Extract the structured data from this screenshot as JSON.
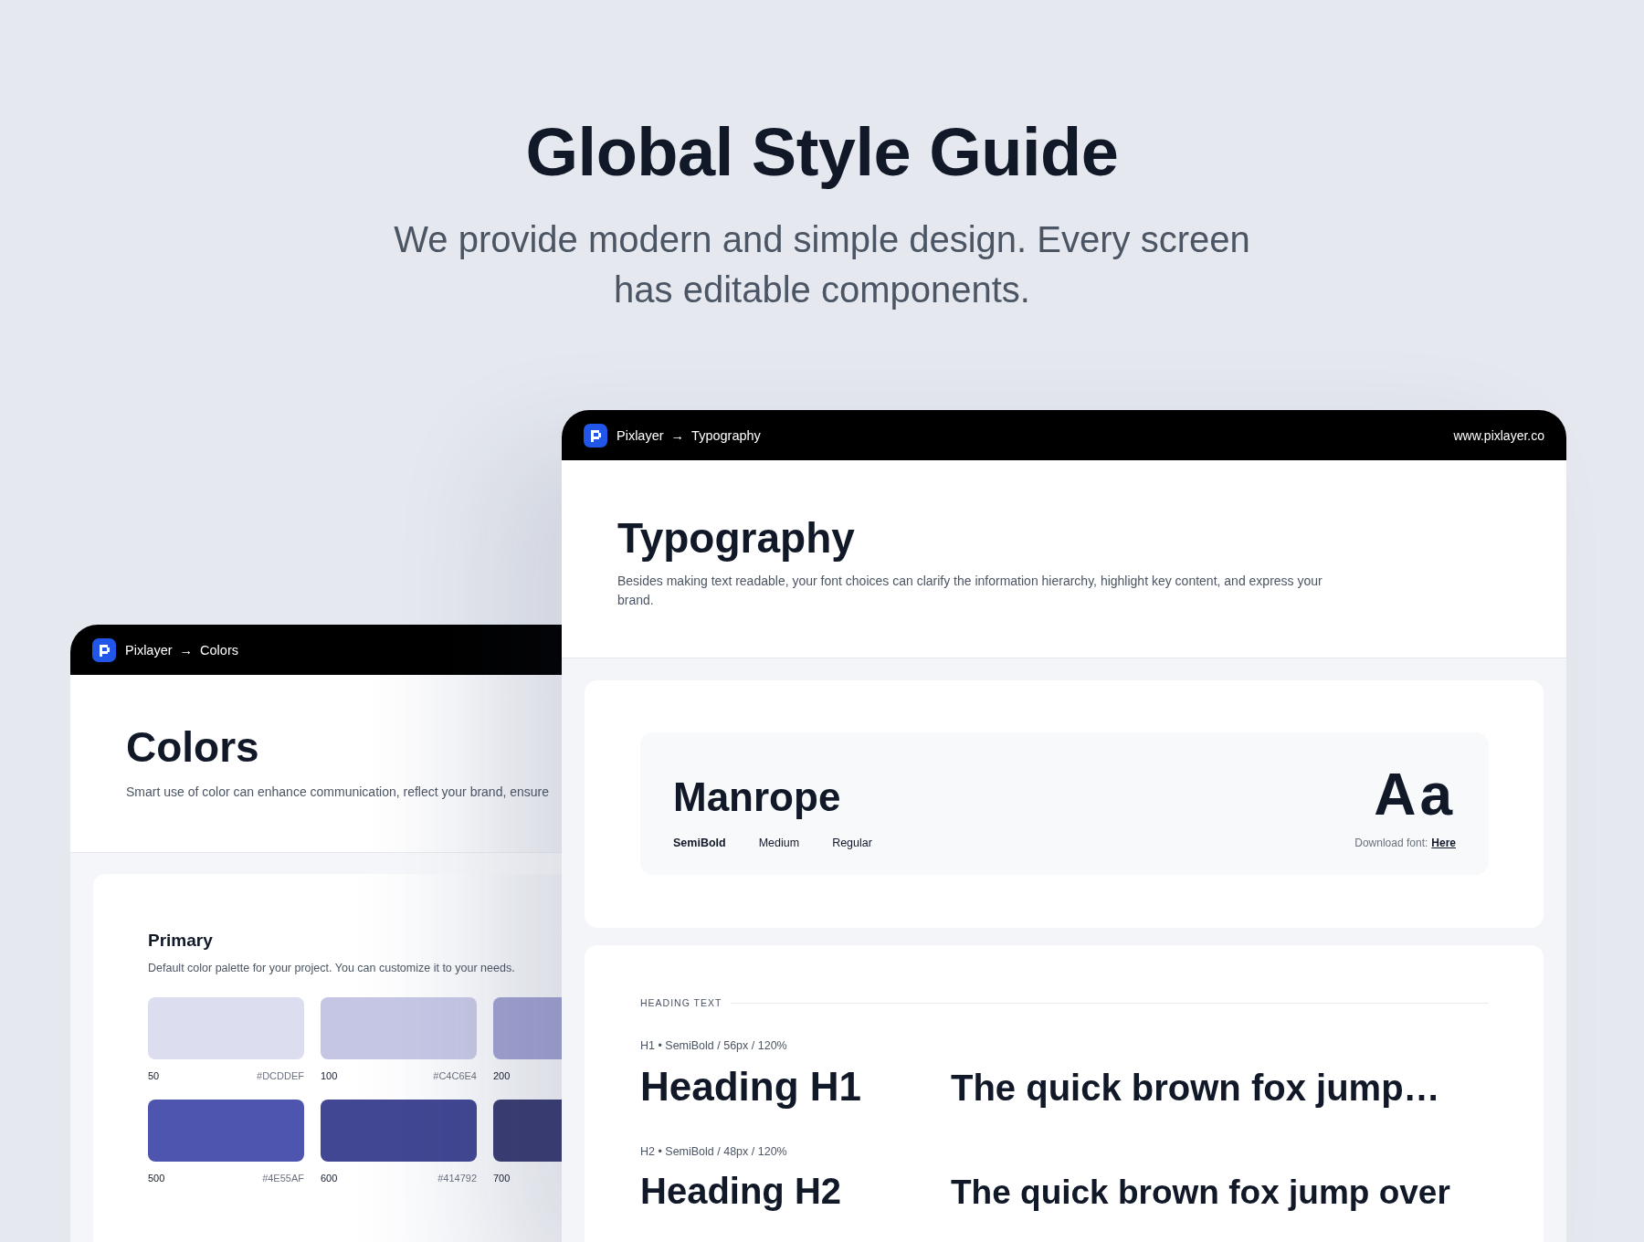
{
  "hero": {
    "title": "Global Style Guide",
    "subtitle": "We provide modern and simple design. Every screen has editable components."
  },
  "colors_window": {
    "breadcrumb": {
      "root": "Pixlayer",
      "arrow": "→",
      "page": "Colors"
    },
    "title": "Colors",
    "description": "Smart use of color can enhance communication, reflect your brand, ensure",
    "palette": {
      "title": "Primary",
      "description": "Default color palette for your project. You can customize it to your needs.",
      "swatches": [
        {
          "label": "50",
          "hex": "#DCDDEF",
          "color": "#dcddef"
        },
        {
          "label": "100",
          "hex": "#C4C6E4",
          "color": "#c4c6e4"
        },
        {
          "label": "200",
          "color": "#9fa1cf"
        },
        {
          "label": "500",
          "hex": "#4E55AF",
          "color": "#4e55af"
        },
        {
          "label": "600",
          "hex": "#414792",
          "color": "#414792"
        },
        {
          "label": "700",
          "color": "#3a3d72"
        }
      ]
    }
  },
  "typography_window": {
    "breadcrumb": {
      "root": "Pixlayer",
      "arrow": "→",
      "page": "Typography"
    },
    "url": "www.pixlayer.co",
    "title": "Typography",
    "description": "Besides making text readable, your font choices can clarify the information hierarchy, highlight key content, and express your brand.",
    "font": {
      "name": "Manrope",
      "weights": [
        "SemiBold",
        "Medium",
        "Regular"
      ],
      "sample": "Aa",
      "download_label": "Download font:",
      "download_link": "Here"
    },
    "heading_section": {
      "label": "HEADING TEXT",
      "styles": [
        {
          "spec": "H1 • SemiBold / 56px / 120%",
          "name": "Heading H1",
          "sample": "The quick brown fox jump…"
        },
        {
          "spec": "H2 • SemiBold / 48px / 120%",
          "name": "Heading H2",
          "sample": "The quick brown fox jump over"
        }
      ]
    }
  }
}
